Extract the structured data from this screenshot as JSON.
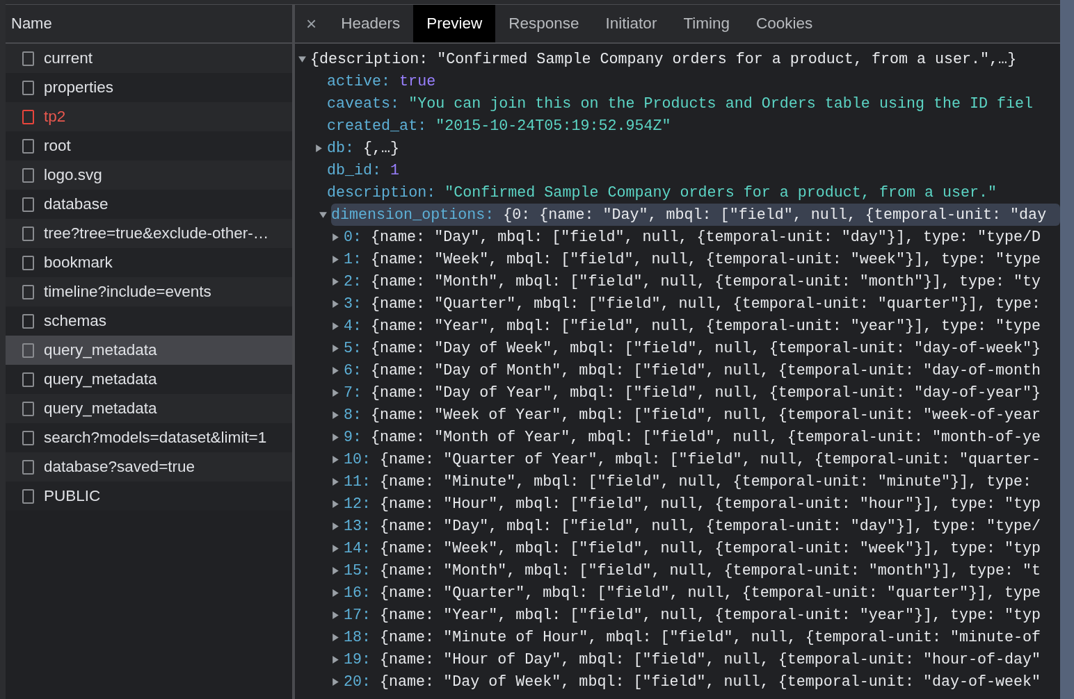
{
  "requests": {
    "column_header": "Name",
    "rows": [
      {
        "name": "current",
        "selected": false,
        "failed": false
      },
      {
        "name": "properties",
        "selected": false,
        "failed": false
      },
      {
        "name": "tp2",
        "selected": false,
        "failed": true
      },
      {
        "name": "root",
        "selected": false,
        "failed": false
      },
      {
        "name": "logo.svg",
        "selected": false,
        "failed": false
      },
      {
        "name": "database",
        "selected": false,
        "failed": false
      },
      {
        "name": "tree?tree=true&exclude-other-…",
        "selected": false,
        "failed": false
      },
      {
        "name": "bookmark",
        "selected": false,
        "failed": false
      },
      {
        "name": "timeline?include=events",
        "selected": false,
        "failed": false
      },
      {
        "name": "schemas",
        "selected": false,
        "failed": false
      },
      {
        "name": "query_metadata",
        "selected": true,
        "failed": false
      },
      {
        "name": "query_metadata",
        "selected": false,
        "failed": false
      },
      {
        "name": "query_metadata",
        "selected": false,
        "failed": false
      },
      {
        "name": "search?models=dataset&limit=1",
        "selected": false,
        "failed": false
      },
      {
        "name": "database?saved=true",
        "selected": false,
        "failed": false
      },
      {
        "name": "PUBLIC",
        "selected": false,
        "failed": false
      }
    ]
  },
  "detail_tabs": {
    "close": "×",
    "tabs": [
      {
        "label": "Headers",
        "selected": false
      },
      {
        "label": "Preview",
        "selected": true
      },
      {
        "label": "Response",
        "selected": false
      },
      {
        "label": "Initiator",
        "selected": false
      },
      {
        "label": "Timing",
        "selected": false
      },
      {
        "label": "Cookies",
        "selected": false
      }
    ]
  },
  "preview": {
    "root": {
      "summary": "{description: \"Confirmed Sample Company orders for a product, from a user.\",…}",
      "expanded": true,
      "selected": false,
      "children": [
        {
          "key": "active:",
          "value": "true",
          "kind": "boolean",
          "selected": false
        },
        {
          "key": "caveats:",
          "value": "\"You can join this on the Products and Orders table using the ID fiel",
          "kind": "string",
          "selected": false
        },
        {
          "key": "created_at:",
          "value": "\"2015-10-24T05:19:52.954Z\"",
          "kind": "string",
          "selected": false
        },
        {
          "key": "db:",
          "value": "{,…}",
          "kind": "object",
          "expanded": false,
          "selected": false
        },
        {
          "key": "db_id:",
          "value": "1",
          "kind": "number",
          "selected": false
        },
        {
          "key": "description:",
          "value": "\"Confirmed Sample Company orders for a product, from a user.\"",
          "kind": "string",
          "selected": false
        },
        {
          "key": "dimension_options:",
          "value": "{0: {name: \"Day\", mbql: [\"field\", null, {temporal-unit: \"day",
          "kind": "object",
          "expanded": true,
          "selected": true,
          "children": [
            {
              "key": "0:",
              "value": "{name: \"Day\", mbql: [\"field\", null, {temporal-unit: \"day\"}], type: \"type/D",
              "kind": "object",
              "expanded": false,
              "selected": false
            },
            {
              "key": "1:",
              "value": "{name: \"Week\", mbql: [\"field\", null, {temporal-unit: \"week\"}], type: \"type",
              "kind": "object",
              "expanded": false,
              "selected": false
            },
            {
              "key": "2:",
              "value": "{name: \"Month\", mbql: [\"field\", null, {temporal-unit: \"month\"}], type: \"ty",
              "kind": "object",
              "expanded": false,
              "selected": false
            },
            {
              "key": "3:",
              "value": "{name: \"Quarter\", mbql: [\"field\", null, {temporal-unit: \"quarter\"}], type:",
              "kind": "object",
              "expanded": false,
              "selected": false
            },
            {
              "key": "4:",
              "value": "{name: \"Year\", mbql: [\"field\", null, {temporal-unit: \"year\"}], type: \"type",
              "kind": "object",
              "expanded": false,
              "selected": false
            },
            {
              "key": "5:",
              "value": "{name: \"Day of Week\", mbql: [\"field\", null, {temporal-unit: \"day-of-week\"}",
              "kind": "object",
              "expanded": false,
              "selected": false
            },
            {
              "key": "6:",
              "value": "{name: \"Day of Month\", mbql: [\"field\", null, {temporal-unit: \"day-of-month",
              "kind": "object",
              "expanded": false,
              "selected": false
            },
            {
              "key": "7:",
              "value": "{name: \"Day of Year\", mbql: [\"field\", null, {temporal-unit: \"day-of-year\"}",
              "kind": "object",
              "expanded": false,
              "selected": false
            },
            {
              "key": "8:",
              "value": "{name: \"Week of Year\", mbql: [\"field\", null, {temporal-unit: \"week-of-year",
              "kind": "object",
              "expanded": false,
              "selected": false
            },
            {
              "key": "9:",
              "value": "{name: \"Month of Year\", mbql: [\"field\", null, {temporal-unit: \"month-of-ye",
              "kind": "object",
              "expanded": false,
              "selected": false
            },
            {
              "key": "10:",
              "value": "{name: \"Quarter of Year\", mbql: [\"field\", null, {temporal-unit: \"quarter-",
              "kind": "object",
              "expanded": false,
              "selected": false
            },
            {
              "key": "11:",
              "value": "{name: \"Minute\", mbql: [\"field\", null, {temporal-unit: \"minute\"}], type:",
              "kind": "object",
              "expanded": false,
              "selected": false
            },
            {
              "key": "12:",
              "value": "{name: \"Hour\", mbql: [\"field\", null, {temporal-unit: \"hour\"}], type: \"typ",
              "kind": "object",
              "expanded": false,
              "selected": false
            },
            {
              "key": "13:",
              "value": "{name: \"Day\", mbql: [\"field\", null, {temporal-unit: \"day\"}], type: \"type/",
              "kind": "object",
              "expanded": false,
              "selected": false
            },
            {
              "key": "14:",
              "value": "{name: \"Week\", mbql: [\"field\", null, {temporal-unit: \"week\"}], type: \"typ",
              "kind": "object",
              "expanded": false,
              "selected": false
            },
            {
              "key": "15:",
              "value": "{name: \"Month\", mbql: [\"field\", null, {temporal-unit: \"month\"}], type: \"t",
              "kind": "object",
              "expanded": false,
              "selected": false
            },
            {
              "key": "16:",
              "value": "{name: \"Quarter\", mbql: [\"field\", null, {temporal-unit: \"quarter\"}], type",
              "kind": "object",
              "expanded": false,
              "selected": false
            },
            {
              "key": "17:",
              "value": "{name: \"Year\", mbql: [\"field\", null, {temporal-unit: \"year\"}], type: \"typ",
              "kind": "object",
              "expanded": false,
              "selected": false
            },
            {
              "key": "18:",
              "value": "{name: \"Minute of Hour\", mbql: [\"field\", null, {temporal-unit: \"minute-of",
              "kind": "object",
              "expanded": false,
              "selected": false
            },
            {
              "key": "19:",
              "value": "{name: \"Hour of Day\", mbql: [\"field\", null, {temporal-unit: \"hour-of-day\"",
              "kind": "object",
              "expanded": false,
              "selected": false
            },
            {
              "key": "20:",
              "value": "{name: \"Day of Week\", mbql: [\"field\", null, {temporal-unit: \"day-of-week\"",
              "kind": "object",
              "expanded": false,
              "selected": false
            }
          ]
        }
      ]
    }
  }
}
